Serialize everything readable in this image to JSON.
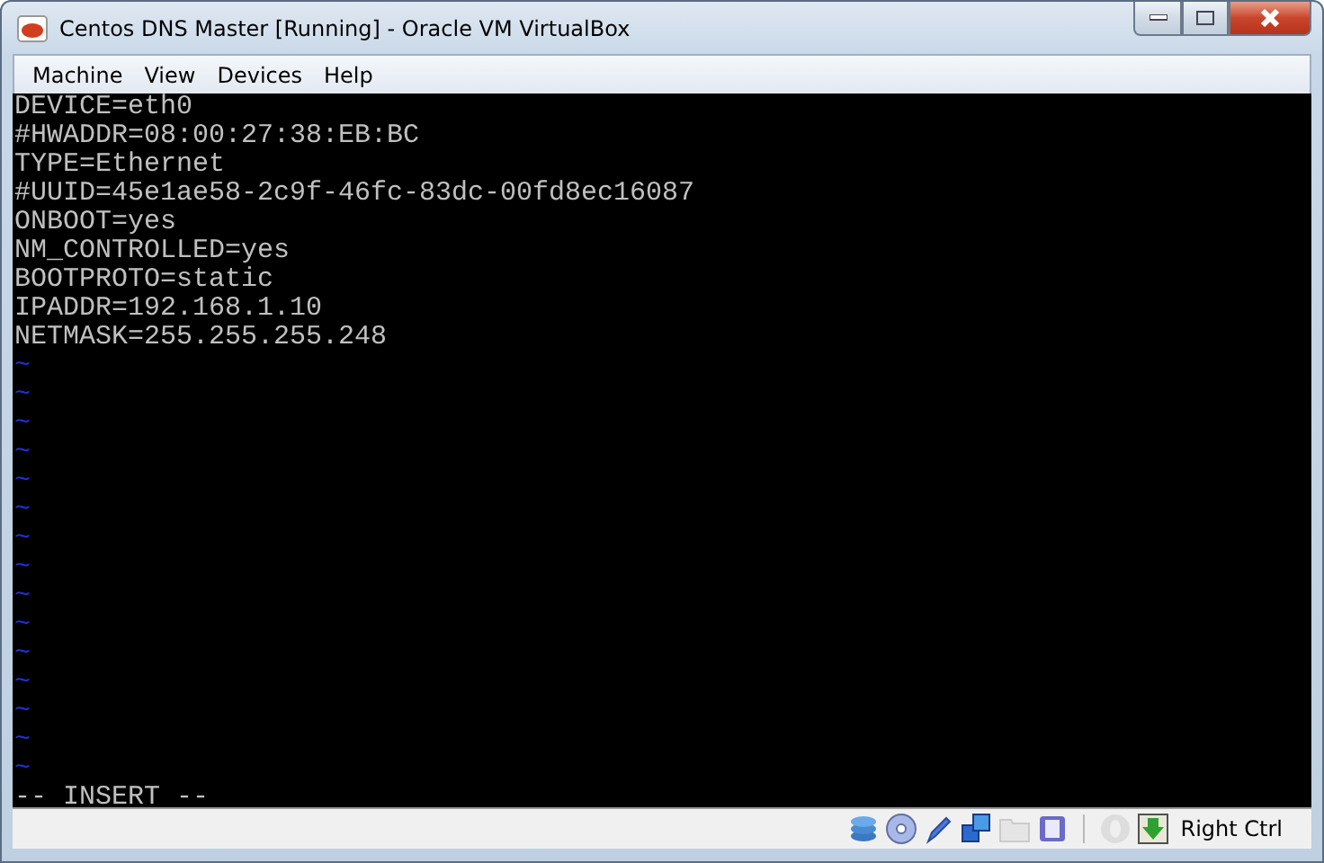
{
  "window": {
    "title": "Centos DNS Master [Running] - Oracle VM VirtualBox"
  },
  "menu": [
    "Machine",
    "View",
    "Devices",
    "Help"
  ],
  "terminal": {
    "lines": [
      "DEVICE=eth0",
      "#HWADDR=08:00:27:38:EB:BC",
      "TYPE=Ethernet",
      "#UUID=45e1ae58-2c9f-46fc-83dc-00fd8ec16087",
      "ONBOOT=yes",
      "NM_CONTROLLED=yes",
      "BOOTPROTO=static",
      "IPADDR=192.168.1.10",
      "NETMASK=255.255.255.248"
    ],
    "empty_lines": [
      "~",
      "~",
      "~",
      "~",
      "~",
      "~",
      "~",
      "~",
      "~",
      "~",
      "~",
      "~",
      "~",
      "~",
      "~"
    ],
    "mode": "-- INSERT --"
  },
  "status_bar": {
    "indicators": [
      {
        "kind": "disk",
        "disabled": false
      },
      {
        "kind": "cd",
        "disabled": false
      },
      {
        "kind": "usb",
        "disabled": false
      },
      {
        "kind": "network",
        "disabled": false
      },
      {
        "kind": "folder",
        "disabled": true
      },
      {
        "kind": "vrdp",
        "disabled": false
      },
      {
        "kind": "separator",
        "disabled": false
      },
      {
        "kind": "mouse",
        "disabled": true
      },
      {
        "kind": "keyboard",
        "disabled": false
      }
    ],
    "host_key": "Right Ctrl"
  }
}
